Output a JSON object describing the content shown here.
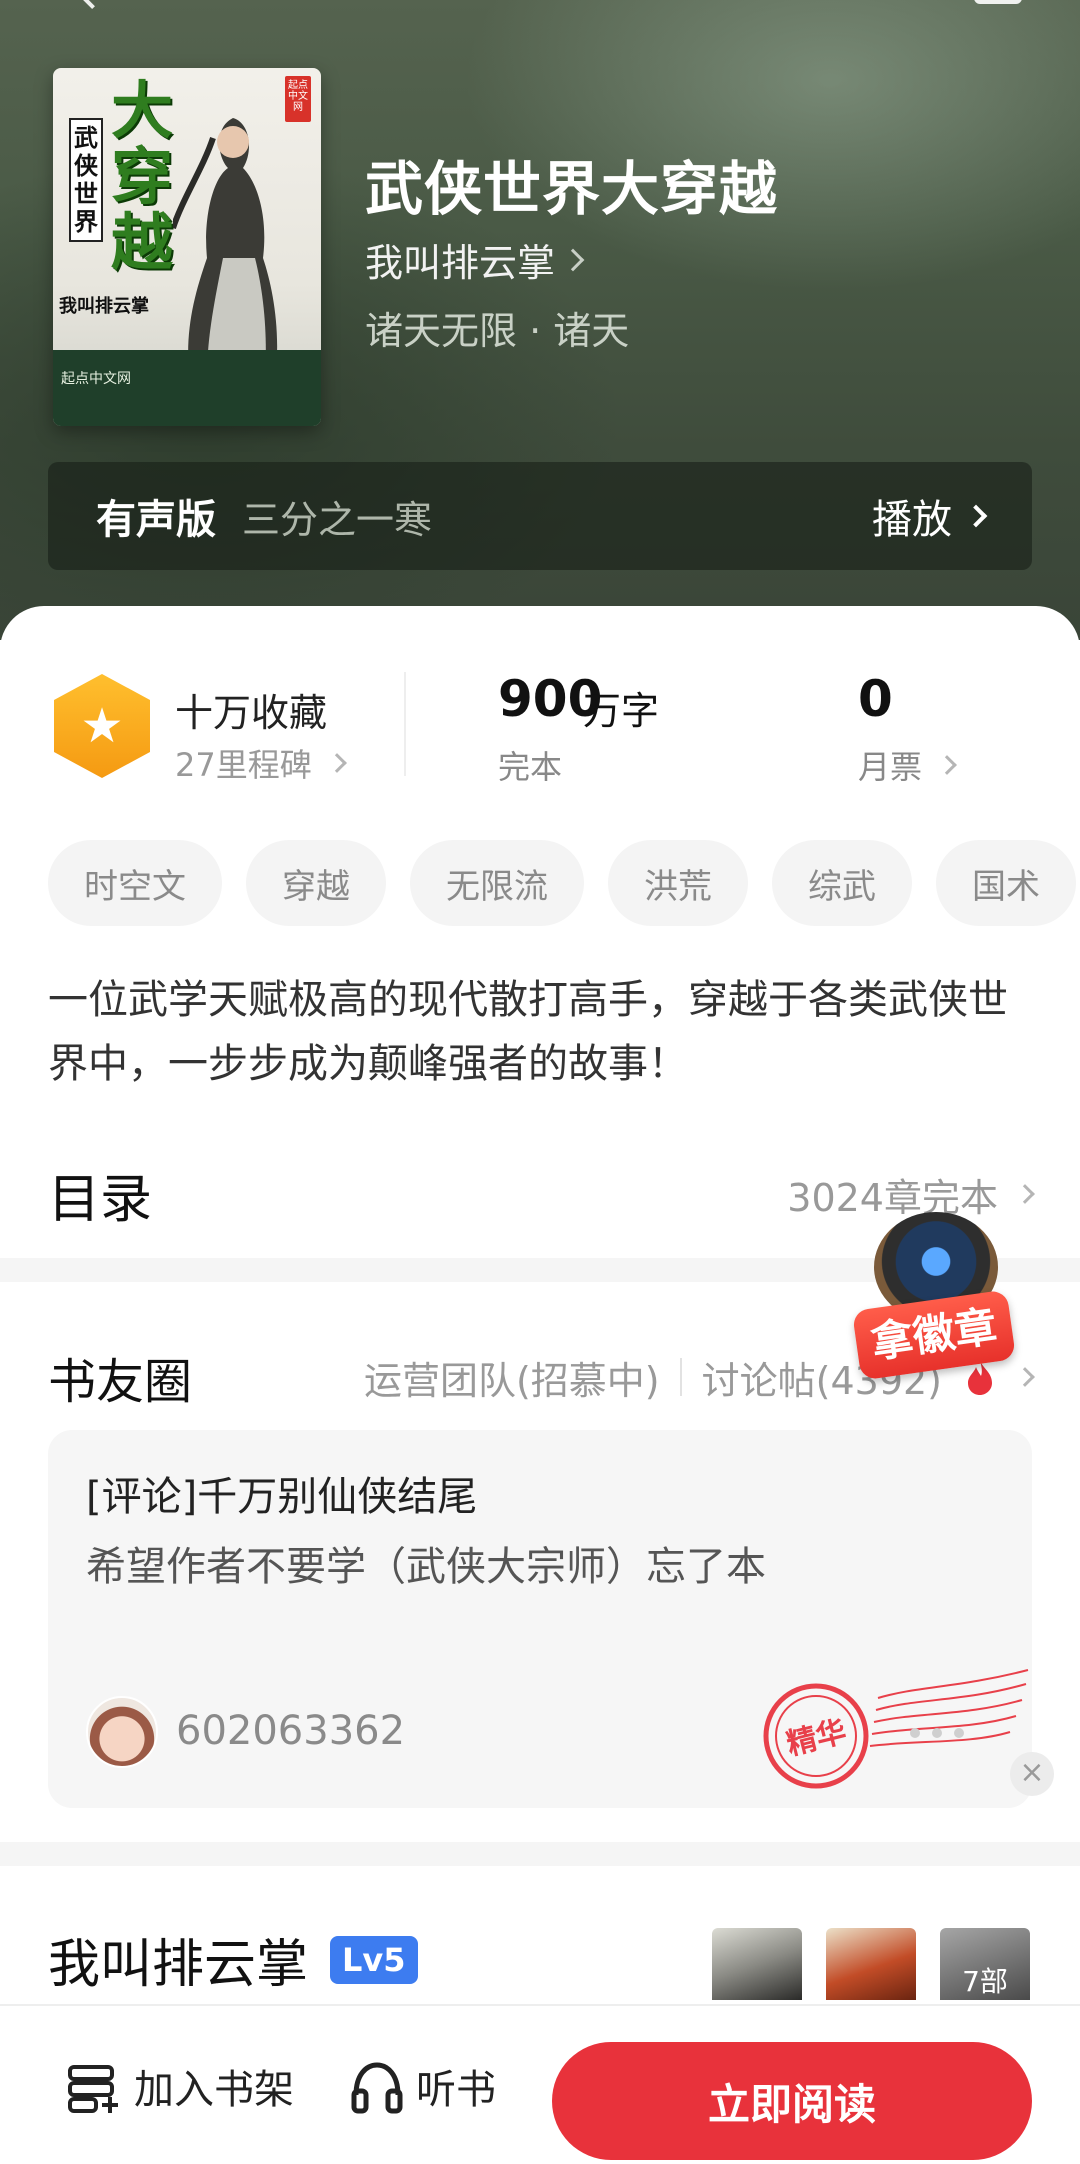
{
  "book": {
    "title": "武侠世界大穿越",
    "author": "我叫排云掌",
    "genre": "诸天无限 · 诸天",
    "cover": {
      "title_vertical": "大穿越",
      "subtitle_vertical": "武侠世界",
      "author": "我叫排云掌",
      "publisher": "起点中文网"
    }
  },
  "audio": {
    "tag": "有声版",
    "narrator": "三分之一寒",
    "play_label": "播放"
  },
  "stats": {
    "collection_title": "十万收藏",
    "collection_sub": "27里程碑",
    "words_number": "900",
    "words_unit": "万字",
    "words_status": "完本",
    "monthly_ticket_count": "0",
    "monthly_ticket_label": "月票"
  },
  "tags": [
    "时空文",
    "穿越",
    "无限流",
    "洪荒",
    "综武",
    "国术"
  ],
  "synopsis": "一位武学天赋极高的现代散打高手，穿越于各类武侠世界中，一步步成为颠峰强者的故事！",
  "toc": {
    "title": "目录",
    "count": "3024章完本"
  },
  "book_circle": {
    "title": "书友圈",
    "ops_team": "运营团队(招慕中)",
    "discussions": "讨论帖(4392)",
    "post": {
      "title": "[评论]千万别仙侠结尾",
      "excerpt": "希望作者不要学（武侠大宗师）忘了本",
      "user": "602063362",
      "stamp": "精华"
    }
  },
  "promo": {
    "label": "拿徽章"
  },
  "author_section": {
    "name": "我叫排云掌",
    "level": "Lv5",
    "works_count": "7部"
  },
  "bottom_bar": {
    "add_shelf": "加入书架",
    "listen": "听书",
    "read_now": "立即阅读"
  },
  "colors": {
    "accent_red": "#e8323b",
    "level_blue": "#3d7cf0",
    "milestone_orange": "#f59a12"
  }
}
